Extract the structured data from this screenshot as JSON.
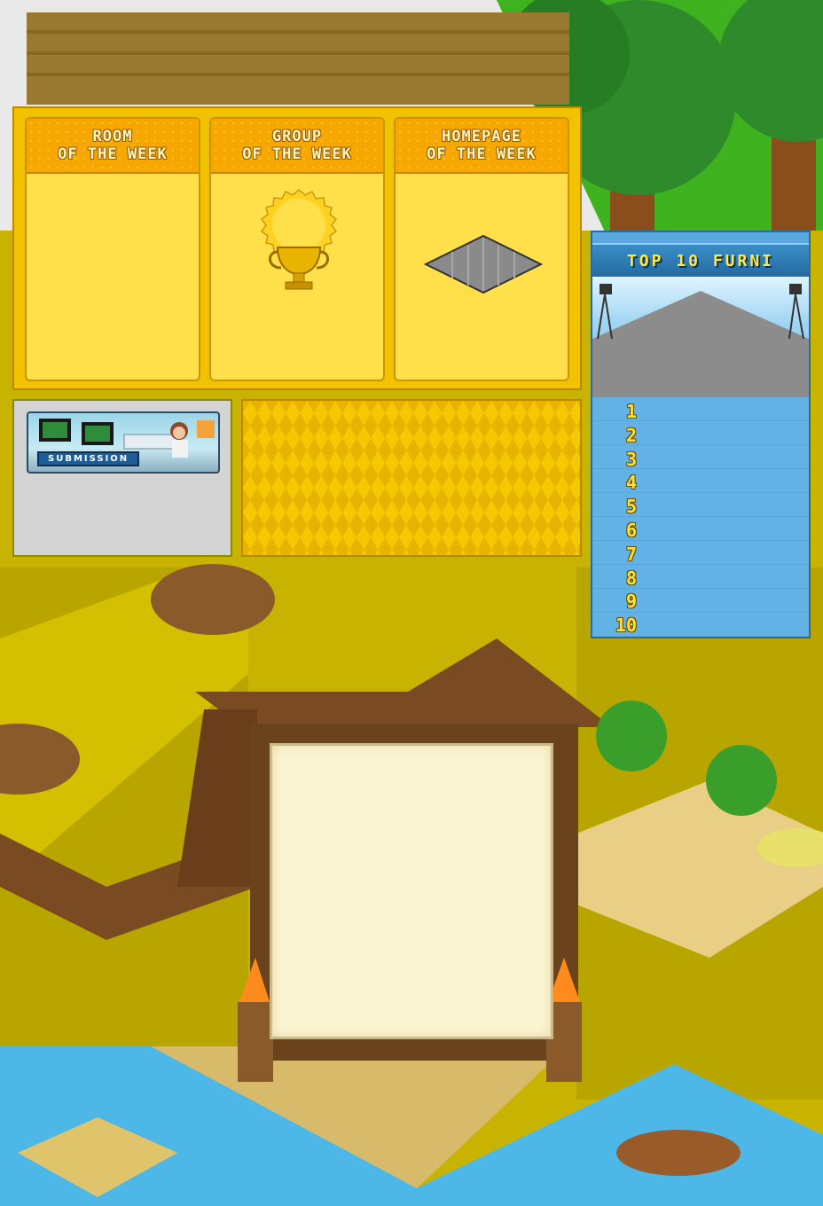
{
  "colors": {
    "ground": "#c8b400",
    "water": "#4db8e8",
    "panel_orange": "#f7a800",
    "panel_yellow": "#ffe04a",
    "top10_blue": "#5aa8e0",
    "top10_title": "#ffe94a"
  },
  "week_panels": [
    {
      "title_line1": "ROOM",
      "title_line2": "OF THE WEEK"
    },
    {
      "title_line1": "GROUP",
      "title_line2": "OF THE WEEK"
    },
    {
      "title_line1": "HOMEPAGE",
      "title_line2": "OF THE WEEK"
    }
  ],
  "submission": {
    "label": "SUBMISSION"
  },
  "top10": {
    "title": "TOP 10 FURNI",
    "ranks": [
      "1",
      "2",
      "3",
      "4",
      "5",
      "6",
      "7",
      "8",
      "9",
      "10"
    ]
  },
  "icons": {
    "group_badge": "trophy-icon",
    "homepage_preview": "tile-icon"
  }
}
